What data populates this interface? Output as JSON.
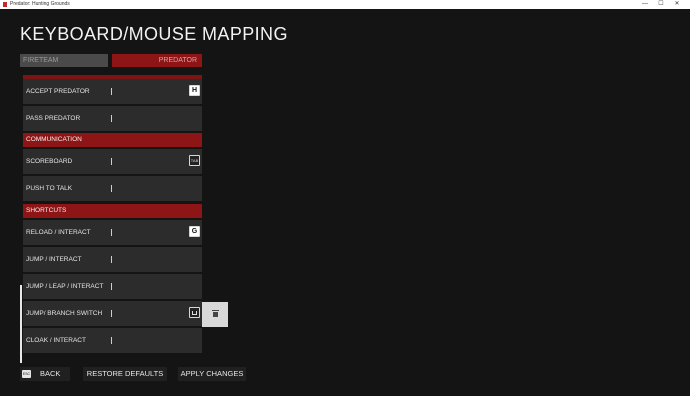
{
  "window": {
    "title": "Predator: Hunting Grounds",
    "controls": [
      "—",
      "☐",
      "✕"
    ]
  },
  "page": {
    "title": "KEYBOARD/MOUSE MAPPING"
  },
  "tabs": [
    "FIRETEAM",
    "PREDATOR"
  ],
  "list": {
    "rows": [
      {
        "label": "ACCEPT PREDATOR",
        "key": "H"
      },
      {
        "label": "PASS PREDATOR",
        "key": ""
      },
      {
        "section": "COMMUNICATION"
      },
      {
        "label": "SCOREBOARD",
        "key": "TAB"
      },
      {
        "label": "PUSH TO TALK",
        "key": ""
      },
      {
        "section": "SHORTCUTS"
      },
      {
        "label": "RELOAD / INTERACT",
        "key": "G"
      },
      {
        "label": "JUMP / INTERACT",
        "key": ""
      },
      {
        "label": "JUMP / LEAP / INTERACT",
        "key": ""
      },
      {
        "label": "JUMP/ BRANCH SWITCH",
        "key": "space-icon"
      },
      {
        "label": "CLOAK / INTERACT",
        "key": ""
      }
    ]
  },
  "footer": {
    "back_key": "ESC",
    "back_label": "BACK",
    "restore_label": "RESTORE DEFAULTS",
    "apply_label": "APPLY CHANGES"
  },
  "colors": {
    "accent": "#8e1515",
    "row_bg": "#2c2c2c",
    "background": "#141414"
  }
}
